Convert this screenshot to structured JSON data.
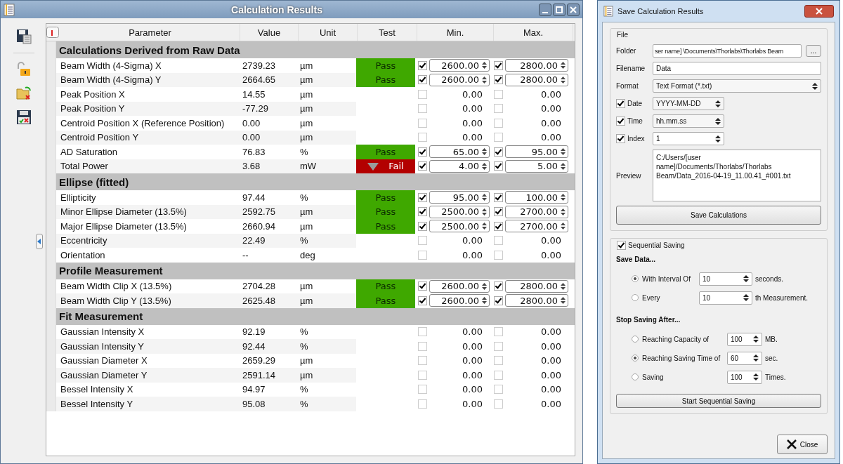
{
  "main_window": {
    "title": "Calculation Results"
  },
  "table": {
    "columns": [
      "Parameter",
      "Value",
      "Unit",
      "Test",
      "Min.",
      "Max."
    ],
    "sections": [
      {
        "title": "Calculations Derived from Raw Data",
        "rows": [
          {
            "parameter": "Beam Width (4-Sigma) X",
            "value": "2739.23",
            "unit": "µm",
            "test": {
              "color": "#3fa800",
              "warning": false,
              "label": "Pass"
            },
            "min_checked": true,
            "min": "2600.00",
            "max_checked": true,
            "max": "2800.00"
          },
          {
            "parameter": "Beam Width (4-Sigma) Y",
            "value": "2664.65",
            "unit": "µm",
            "test": {
              "color": "#3fa800",
              "warning": false,
              "label": "Pass"
            },
            "min_checked": true,
            "min": "2600.00",
            "max_checked": true,
            "max": "2800.00"
          },
          {
            "parameter": "Peak Position X",
            "value": "14.55",
            "unit": "µm",
            "min_checked": false,
            "min": "0.00",
            "max_checked": false,
            "max": "0.00"
          },
          {
            "parameter": "Peak Position Y",
            "value": "-77.29",
            "unit": "µm",
            "min_checked": false,
            "min": "0.00",
            "max_checked": false,
            "max": "0.00"
          },
          {
            "parameter": "Centroid Position X (Reference Position)",
            "value": "0.00",
            "unit": "µm",
            "min_checked": false,
            "min": "0.00",
            "max_checked": false,
            "max": "0.00"
          },
          {
            "parameter": "Centroid Position Y",
            "value": "0.00",
            "unit": "µm",
            "min_checked": false,
            "min": "0.00",
            "max_checked": false,
            "max": "0.00"
          },
          {
            "parameter": "AD Saturation",
            "value": "76.83",
            "unit": "%",
            "test": {
              "color": "#3fa800",
              "warning": false,
              "label": "Pass"
            },
            "min_checked": true,
            "min": "65.00",
            "max_checked": true,
            "max": "95.00"
          },
          {
            "parameter": "Total Power",
            "value": "3.68",
            "unit": "mW",
            "test": {
              "color": "#b30000",
              "warning": true,
              "label": "Fail"
            },
            "min_checked": true,
            "min": "4.00",
            "max_checked": true,
            "max": "5.00"
          }
        ]
      },
      {
        "title": "Ellipse (fitted)",
        "rows": [
          {
            "parameter": "Ellipticity",
            "value": "97.44",
            "unit": "%",
            "test": {
              "color": "#3fa800",
              "warning": false,
              "label": "Pass"
            },
            "min_checked": true,
            "min": "95.00",
            "max_checked": true,
            "max": "100.00"
          },
          {
            "parameter": "Minor Ellipse Diameter (13.5%)",
            "value": "2592.75",
            "unit": "µm",
            "test": {
              "color": "#3fa800",
              "warning": false,
              "label": "Pass"
            },
            "min_checked": true,
            "min": "2500.00",
            "max_checked": true,
            "max": "2700.00"
          },
          {
            "parameter": "Major Ellipse Diameter (13.5%)",
            "value": "2660.94",
            "unit": "µm",
            "test": {
              "color": "#3fa800",
              "warning": false,
              "label": "Pass"
            },
            "min_checked": true,
            "min": "2500.00",
            "max_checked": true,
            "max": "2700.00"
          },
          {
            "parameter": "Eccentricity",
            "value": "22.49",
            "unit": "%",
            "min_checked": false,
            "min": "0.00",
            "max_checked": false,
            "max": "0.00"
          },
          {
            "parameter": "Orientation",
            "value": "--",
            "unit": "deg",
            "min_checked": false,
            "min": "0.00",
            "max_checked": false,
            "max": "0.00"
          }
        ]
      },
      {
        "title": "Profile Measurement",
        "rows": [
          {
            "parameter": "Beam Width Clip X (13.5%)",
            "value": "2704.28",
            "unit": "µm",
            "test": {
              "color": "#3fa800",
              "warning": false,
              "label": "Pass"
            },
            "min_checked": true,
            "min": "2600.00",
            "max_checked": true,
            "max": "2800.00"
          },
          {
            "parameter": "Beam Width Clip Y (13.5%)",
            "value": "2625.48",
            "unit": "µm",
            "test": {
              "color": "#3fa800",
              "warning": false,
              "label": "Pass"
            },
            "min_checked": true,
            "min": "2600.00",
            "max_checked": true,
            "max": "2800.00"
          }
        ]
      },
      {
        "title": "Fit Measurement",
        "rows": [
          {
            "parameter": "Gaussian Intensity X",
            "value": "92.19",
            "unit": "%",
            "min_checked": false,
            "min": "0.00",
            "max_checked": false,
            "max": "0.00"
          },
          {
            "parameter": "Gaussian Intensity Y",
            "value": "92.44",
            "unit": "%",
            "min_checked": false,
            "min": "0.00",
            "max_checked": false,
            "max": "0.00"
          },
          {
            "parameter": "Gaussian Diameter X",
            "value": "2659.29",
            "unit": "µm",
            "min_checked": false,
            "min": "0.00",
            "max_checked": false,
            "max": "0.00"
          },
          {
            "parameter": "Gaussian Diameter Y",
            "value": "2591.14",
            "unit": "µm",
            "min_checked": false,
            "min": "0.00",
            "max_checked": false,
            "max": "0.00"
          },
          {
            "parameter": "Bessel Intensity X",
            "value": "94.97",
            "unit": "%",
            "min_checked": false,
            "min": "0.00",
            "max_checked": false,
            "max": "0.00"
          },
          {
            "parameter": "Bessel Intensity Y",
            "value": "95.08",
            "unit": "%",
            "min_checked": false,
            "min": "0.00",
            "max_checked": false,
            "max": "0.00"
          }
        ]
      }
    ]
  },
  "dialog": {
    "title": "Save Calculation Results",
    "file_group": {
      "title": "File",
      "folder_label": "Folder",
      "folder": "ser name] \\Documents\\Thorlabs\\Thorlabs Beam",
      "browse": "...",
      "filename_label": "Filename",
      "filename": "Data",
      "format_label": "Format",
      "format": "Text Format (*.txt)",
      "options": [
        {
          "kind": "combo",
          "label": "Date",
          "checked": true,
          "value": "YYYY-MM-DD"
        },
        {
          "kind": "combo",
          "label": "Time",
          "checked": true,
          "value": "hh.mm.ss"
        },
        {
          "kind": "spin",
          "label": "Index",
          "checked": true,
          "value": "1"
        }
      ],
      "preview_label": "Preview",
      "preview": "C:/Users/[user name]/Documents/Thorlabs/Thorlabs Beam/Data_2016-04-19_11.00.41_#001.txt",
      "save_button": "Save Calculations"
    },
    "sequential_group": {
      "title": "Sequential Saving",
      "checked": true,
      "save_heading": "Save Data...",
      "save_options": [
        {
          "label": "With Interval Of",
          "value": "10",
          "unit": "seconds.",
          "selected": true
        },
        {
          "label": "Every",
          "value": "10",
          "unit": "th Measurement.",
          "selected": false
        }
      ],
      "stop_heading": "Stop Saving After...",
      "stop_options": [
        {
          "label": "Reaching Capacity of",
          "value": "100",
          "unit": "MB.",
          "selected": false
        },
        {
          "label": "Reaching Saving Time of",
          "value": "60",
          "unit": "sec.",
          "selected": true
        },
        {
          "label": "Saving",
          "value": "100",
          "unit": "Times.",
          "selected": false
        }
      ],
      "start_button": "Start Sequential Saving"
    },
    "close_button": "Close"
  }
}
